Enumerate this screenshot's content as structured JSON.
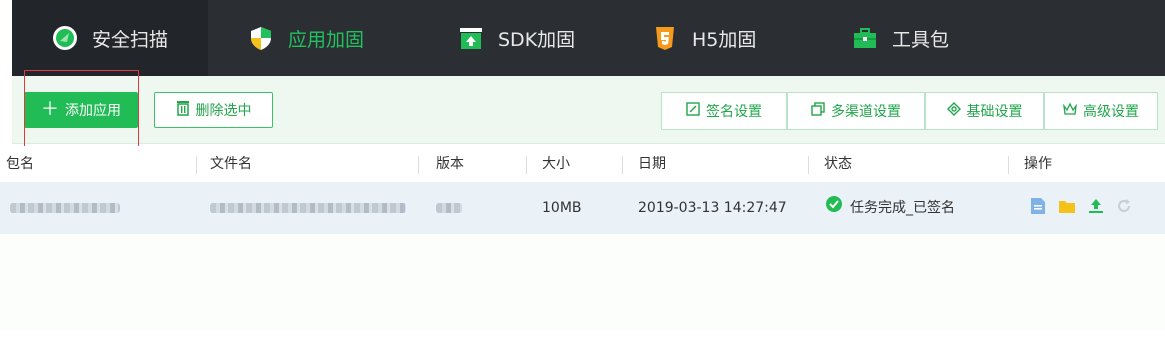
{
  "tabs": [
    {
      "label": "安全扫描",
      "icon": "scan-shield-icon"
    },
    {
      "label": "应用加固",
      "icon": "shield-icon"
    },
    {
      "label": "SDK加固",
      "icon": "upload-box-icon"
    },
    {
      "label": "H5加固",
      "icon": "html5-icon"
    },
    {
      "label": "工具包",
      "icon": "toolbox-icon"
    }
  ],
  "toolbar": {
    "add_label": "添加应用",
    "delete_label": "删除选中",
    "sign_label": "签名设置",
    "channel_label": "多渠道设置",
    "basic_label": "基础设置",
    "advanced_label": "高级设置"
  },
  "table": {
    "headers": [
      "包名",
      "文件名",
      "版本",
      "大小",
      "日期",
      "状态",
      "操作"
    ],
    "rows": [
      {
        "size": "10MB",
        "date": "2019-03-13 14:27:47",
        "status": "任务完成_已签名"
      }
    ]
  },
  "colors": {
    "accent": "#21bc55",
    "dark_bar": "#2b2f33",
    "highlight": "#e0393e"
  }
}
